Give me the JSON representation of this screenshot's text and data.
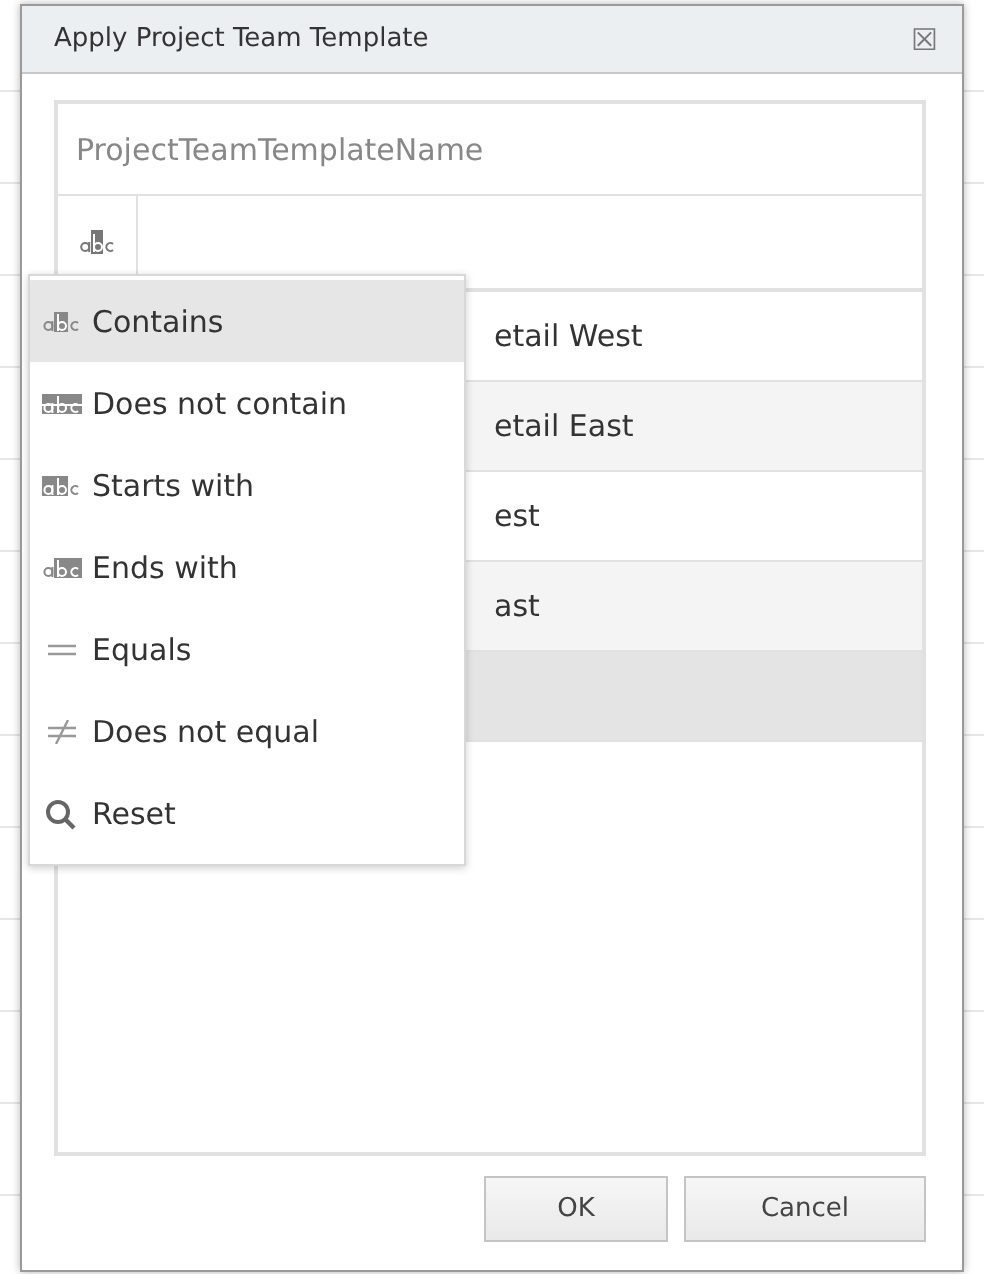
{
  "dialog": {
    "title": "Apply Project Team Template",
    "close_glyph": "☒"
  },
  "grid": {
    "column": "ProjectTeamTemplateName",
    "rows": [
      {
        "text": "etail West",
        "selected": false
      },
      {
        "text": "etail East",
        "selected": false
      },
      {
        "text": "est",
        "selected": false
      },
      {
        "text": "ast",
        "selected": false
      },
      {
        "text": "",
        "selected": true
      }
    ]
  },
  "filter_menu": {
    "items": [
      {
        "kind": "contains",
        "label": "Contains",
        "selected": true
      },
      {
        "kind": "not_contains",
        "label": "Does not contain",
        "selected": false
      },
      {
        "kind": "starts",
        "label": "Starts with",
        "selected": false
      },
      {
        "kind": "ends",
        "label": "Ends with",
        "selected": false
      },
      {
        "kind": "equals",
        "label": "Equals",
        "selected": false
      },
      {
        "kind": "not_equals",
        "label": "Does not equal",
        "selected": false
      },
      {
        "kind": "reset",
        "label": "Reset",
        "selected": false
      }
    ]
  },
  "buttons": [
    "OK",
    "Cancel"
  ]
}
